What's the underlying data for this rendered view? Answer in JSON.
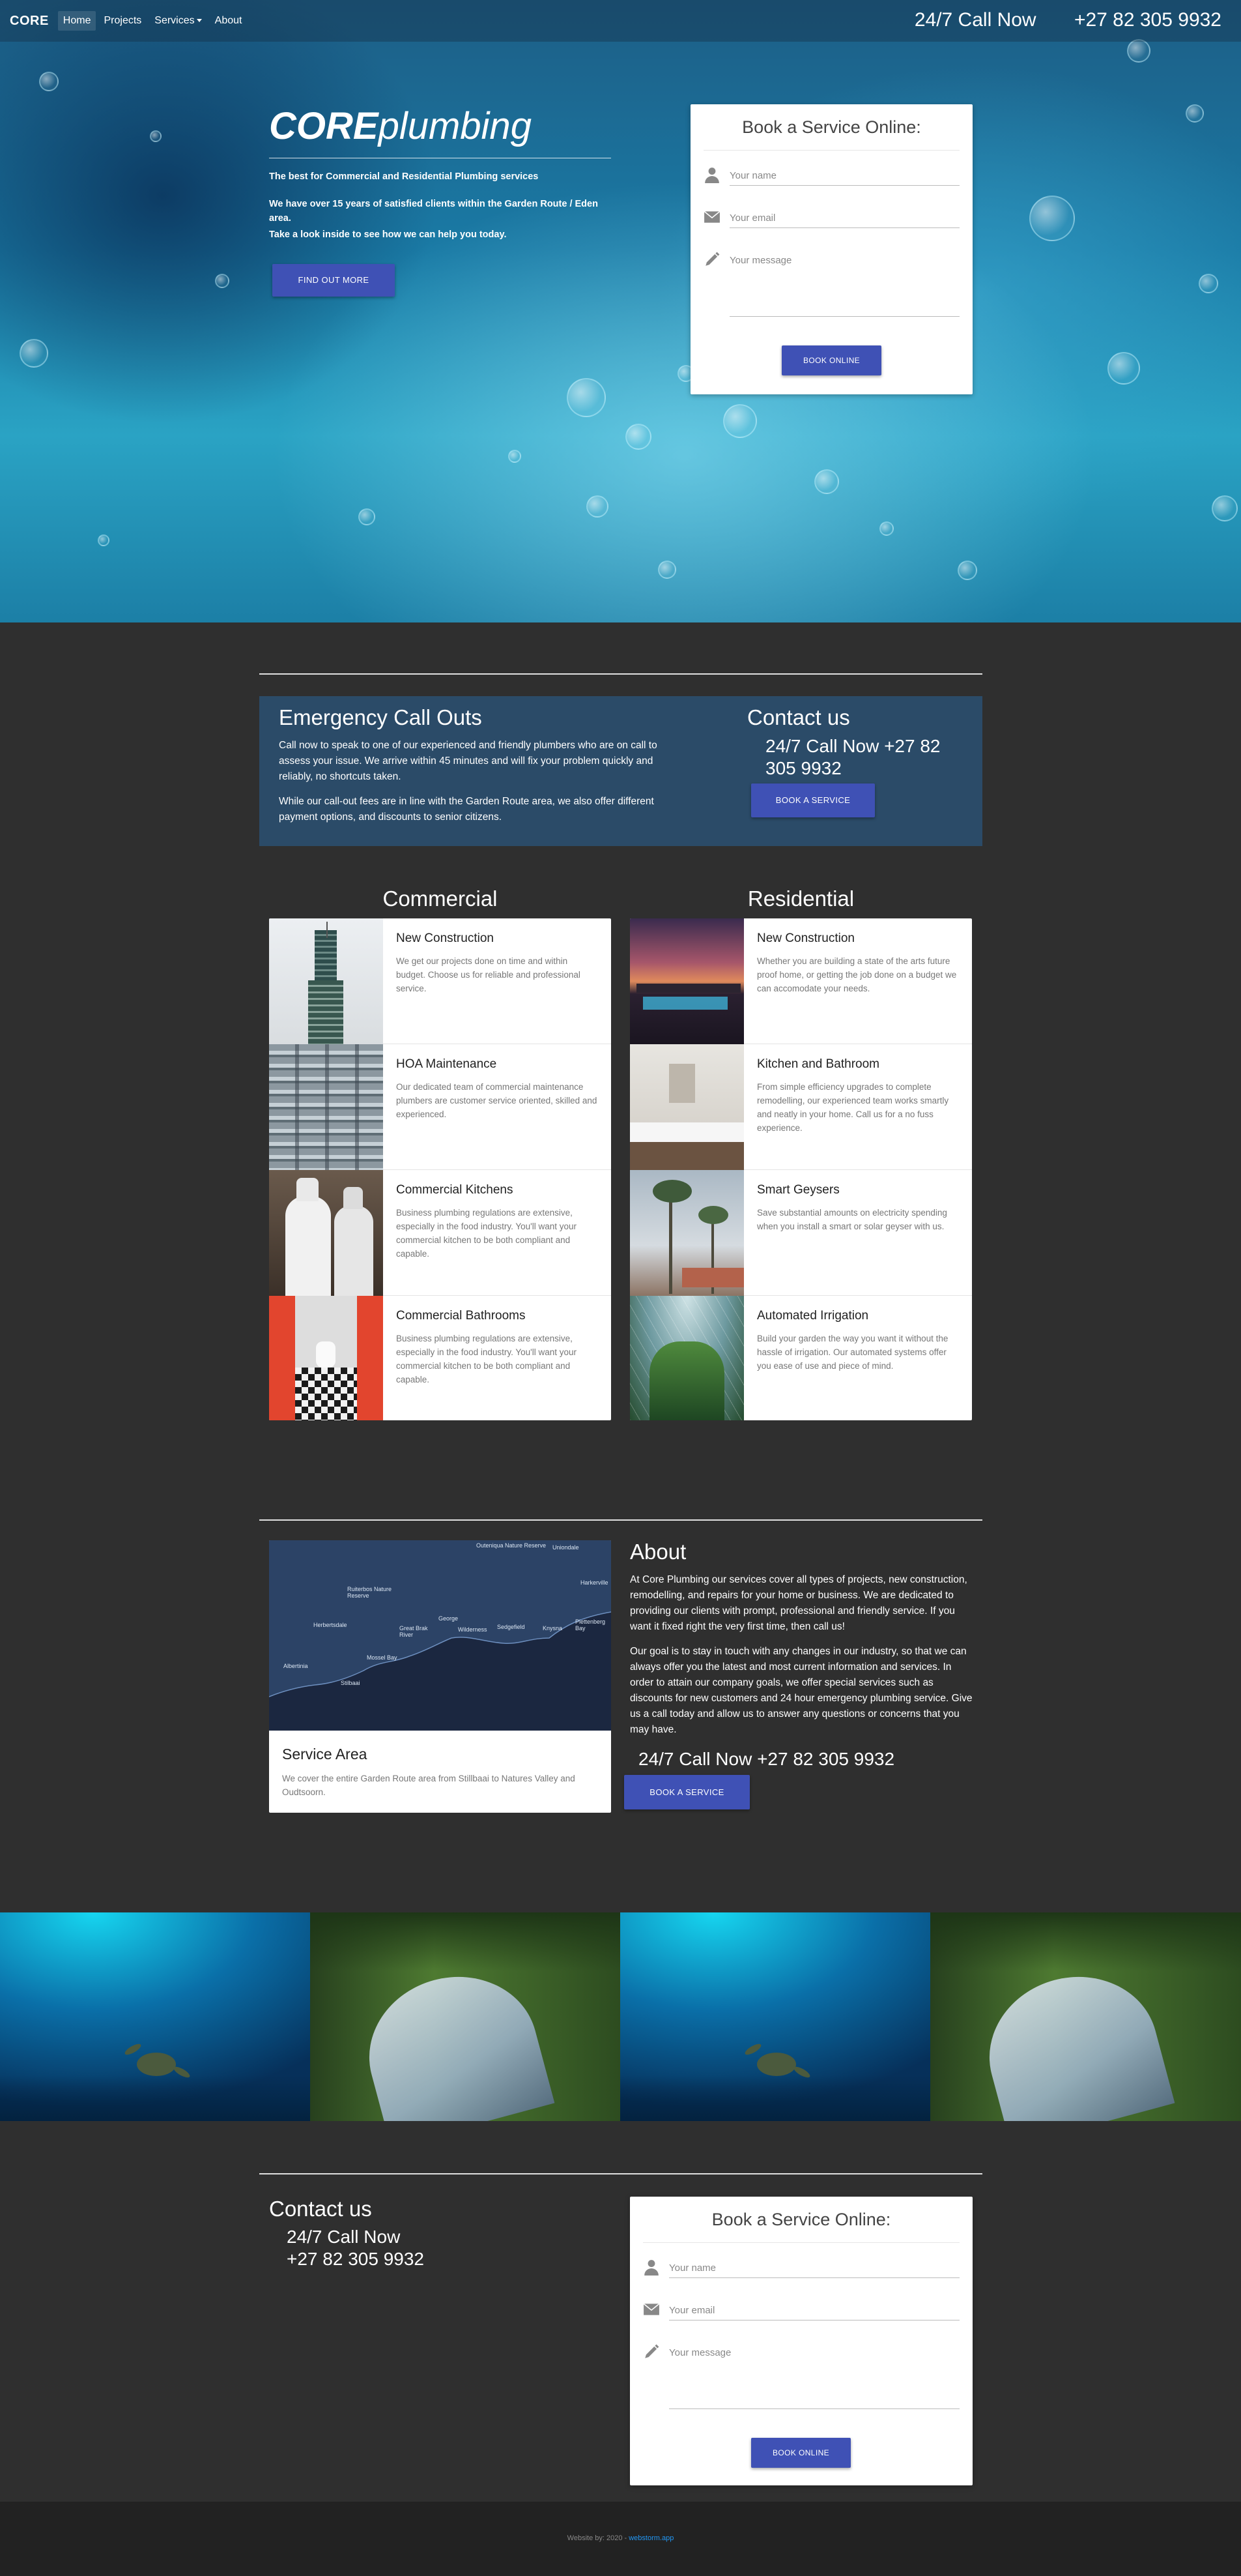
{
  "nav": {
    "brand": "CORE",
    "links": [
      "Home",
      "Projects",
      "Services",
      "About"
    ],
    "call_label": "24/7 Call Now",
    "phone": "+27 82 305 9932"
  },
  "hero": {
    "title_bold": "CORE",
    "title_rest": "plumbing",
    "tagline": "The best for Commercial and Residential Plumbing services",
    "text1": "We have over 15 years of satisfied clients within the Garden Route / Eden area.",
    "text2": "Take a look inside to see how we can help you today.",
    "cta": "FIND OUT MORE"
  },
  "booking": {
    "title": "Book a Service Online:",
    "name_placeholder": "Your name",
    "email_placeholder": "Your email",
    "message_placeholder": "Your message",
    "submit": "BOOK ONLINE"
  },
  "emergency": {
    "title": "Emergency Call Outs",
    "p1": "Call now to speak to one of our experienced and friendly plumbers who are on call to assess your issue. We arrive within 45 minutes and will fix your problem quickly and reliably, no shortcuts taken.",
    "p2": "While our call-out fees are in line with the Garden Route area, we also offer different payment options, and discounts to senior citizens.",
    "contact_title": "Contact us",
    "contact_phone": "24/7 Call Now +27 82 305 9932",
    "button": "BOOK A SERVICE"
  },
  "services": {
    "commercial": {
      "title": "Commercial",
      "items": [
        {
          "title": "New Construction",
          "desc": "We get our projects done on time and within budget. Choose us for reliable and professional service."
        },
        {
          "title": "HOA Maintenance",
          "desc": "Our dedicated team of commercial maintenance plumbers are customer service oriented, skilled and experienced."
        },
        {
          "title": "Commercial Kitchens",
          "desc": "Business plumbing regulations are extensive, especially in the food industry. You'll want your commercial kitchen to be both compliant and capable."
        },
        {
          "title": "Commercial Bathrooms",
          "desc": "Business plumbing regulations are extensive, especially in the food industry. You'll want your commercial kitchen to be both compliant and capable."
        }
      ]
    },
    "residential": {
      "title": "Residential",
      "items": [
        {
          "title": "New Construction",
          "desc": "Whether you are building a state of the arts future proof home, or getting the job done on a budget we can accomodate your needs."
        },
        {
          "title": "Kitchen and Bathroom",
          "desc": "From simple efficiency upgrades to complete remodelling, our experienced team works smartly and neatly in your home. Call us for a no fuss experience."
        },
        {
          "title": "Smart Geysers",
          "desc": "Save substantial amounts on electricity spending when you install a smart or solar geyser with us."
        },
        {
          "title": "Automated Irrigation",
          "desc": "Build your garden the way you want it without the hassle of irrigation. Our automated systems offer you ease of use and piece of mind."
        }
      ]
    }
  },
  "service_area": {
    "title": "Service Area",
    "desc": "We cover the entire Garden Route area from Stillbaai to Natures Valley and Oudtsoorn.",
    "map_labels": [
      "Outeniqua Nature Reserve",
      "Uniondale",
      "Ruiterbos Nature Reserve",
      "Herbertsdale",
      "Great Brak River",
      "George",
      "Wilderness",
      "Sedgefield",
      "Knysna",
      "Plettenberg Bay",
      "Mossel Bay",
      "Albertinia",
      "Stilbaai",
      "Harkerville"
    ]
  },
  "about": {
    "title": "About",
    "p1": "At Core Plumbing our services cover all types of projects, new construction, remodelling, and repairs for your home or business. We are dedicated to providing our clients with prompt, professional and friendly service. If you want it fixed right the very first time, then call us!",
    "p2": "Our goal is to stay in touch with any changes in our industry, so that we can always offer you the latest and most current information and services. In order to attain our company goals, we offer special services such as discounts for new customers and 24 hour emergency plumbing service. Give us a call today and allow us to answer any questions or concerns that you may have.",
    "phone": "24/7 Call Now +27 82 305 9932",
    "button": "BOOK A SERVICE"
  },
  "contact": {
    "title": "Contact us",
    "call_label": "24/7 Call Now",
    "phone": "+27 82 305 9932"
  },
  "footer": {
    "text": "Website by: 2020 -",
    "link": "webstorm.app"
  },
  "colors": {
    "accent": "#3f51b5",
    "dark_bg": "#2f2f2f",
    "emergency_bg": "#2b4b68",
    "footer_bg": "#222222",
    "link": "#2196f3"
  }
}
